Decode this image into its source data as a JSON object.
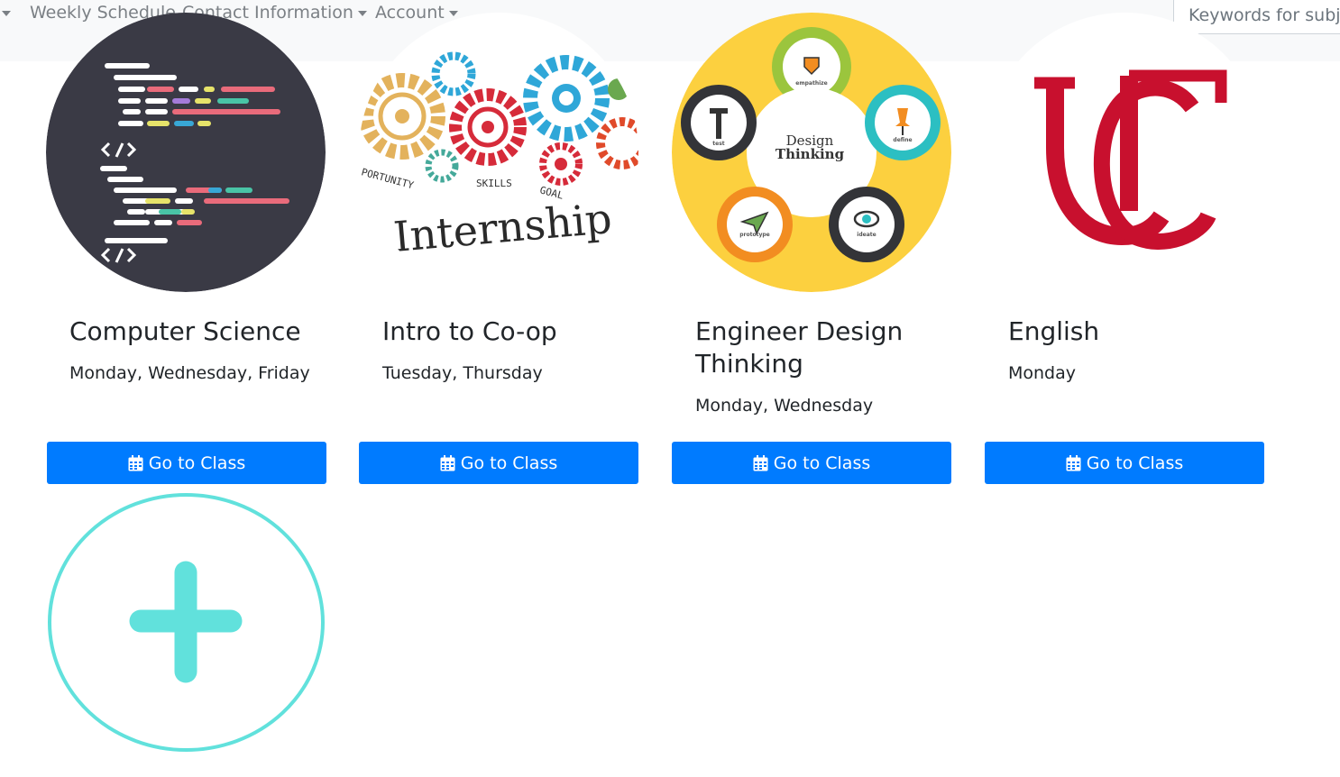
{
  "nav": {
    "weekly_schedule": "Weekly Schedule",
    "contact_information": "Contact Information",
    "account": "Account",
    "search_placeholder": "Keywords for subje"
  },
  "classes": [
    {
      "title": "Computer Science",
      "days": "Monday, Wednesday, Friday",
      "button": "Go to Class"
    },
    {
      "title": "Intro to Co-op",
      "days": "Tuesday, Thursday",
      "button": "Go to Class",
      "image_text": {
        "word": "Internship",
        "opportunity": "PORTUNITY",
        "skills": "SKILLS",
        "goal": "GOAL"
      }
    },
    {
      "title_line1": "Engineer Design",
      "title_line2": "Thinking",
      "days": "Monday, Wednesday",
      "button": "Go to Class",
      "image_text": {
        "center1": "Design",
        "center2": "Thinking",
        "empathize": "empathize",
        "define": "define",
        "ideate": "ideate",
        "prototype": "prototype",
        "test": "test"
      }
    },
    {
      "title": "English",
      "days": "Monday",
      "button": "Go to Class"
    }
  ],
  "colors": {
    "primary": "#007bff",
    "add_accent": "#61e1dc",
    "uc_red": "#c8102e"
  },
  "icons": {
    "button": "calendar-icon",
    "add": "plus-circle-icon"
  }
}
